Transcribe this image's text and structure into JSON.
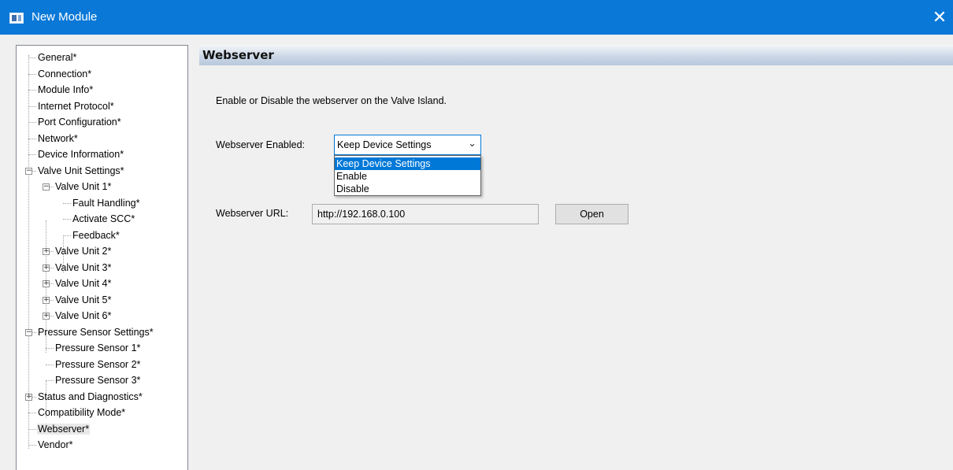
{
  "window": {
    "title": "New Module",
    "close_glyph": "✕",
    "icon": "app-window-icon",
    "accent_color": "#0a78d7"
  },
  "tree": {
    "items": [
      {
        "label": "General*"
      },
      {
        "label": "Connection*"
      },
      {
        "label": "Module Info*"
      },
      {
        "label": "Internet Protocol*"
      },
      {
        "label": "Port Configuration*"
      },
      {
        "label": "Network*"
      },
      {
        "label": "Device Information*"
      },
      {
        "label": "Valve Unit Settings*",
        "expander": "⊟"
      },
      {
        "label": "Valve Unit 1*",
        "expander": "⊟"
      },
      {
        "label": "Fault Handling*"
      },
      {
        "label": "Activate SCC*"
      },
      {
        "label": "Feedback*"
      },
      {
        "label": "Valve Unit 2*",
        "expander": "⊞"
      },
      {
        "label": "Valve Unit 3*",
        "expander": "⊞"
      },
      {
        "label": "Valve Unit 4*",
        "expander": "⊞"
      },
      {
        "label": "Valve Unit 5*",
        "expander": "⊞"
      },
      {
        "label": "Valve Unit 6*",
        "expander": "⊞"
      },
      {
        "label": "Pressure Sensor Settings*",
        "expander": "⊟"
      },
      {
        "label": "Pressure Sensor 1*"
      },
      {
        "label": "Pressure Sensor 2*"
      },
      {
        "label": "Pressure Sensor 3*"
      },
      {
        "label": "Status and Diagnostics*",
        "expander": "⊞"
      },
      {
        "label": "Compatibility Mode*"
      },
      {
        "label": "Webserver*",
        "selected": true
      },
      {
        "label": "Vendor*"
      }
    ]
  },
  "panel": {
    "title": "Webserver",
    "description": "Enable or Disable the webserver on the Valve Island.",
    "enabled_label": "Webserver Enabled:",
    "select_value": "Keep Device Settings",
    "options": [
      "Keep Device Settings",
      "Enable",
      "Disable"
    ],
    "url_label": "Webserver URL:",
    "url_value": "http://192.168.0.100",
    "open_label": "Open"
  }
}
